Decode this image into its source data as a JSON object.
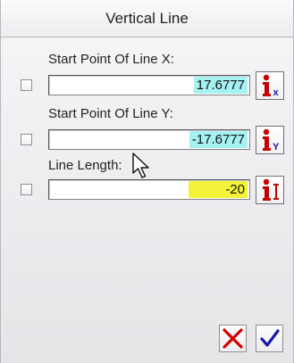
{
  "dialog": {
    "title": "Vertical Line"
  },
  "fields": [
    {
      "label": "Start Point Of Line X:",
      "value": "17.6777",
      "highlight": "#a6f2f3",
      "icon": "info-x-icon",
      "icon_sub": "x",
      "checked": false
    },
    {
      "label": "Start Point Of Line Y:",
      "value": "-17.6777",
      "highlight": "#a6f2f3",
      "icon": "info-y-icon",
      "icon_sub": "Y",
      "checked": false
    },
    {
      "label": "Line Length:",
      "value": "-20",
      "highlight": "#f3f33a",
      "icon": "length-icon",
      "icon_sub": "",
      "checked": false
    }
  ],
  "actions": {
    "cancel_icon": "red-x-icon",
    "ok_icon": "blue-check-icon"
  },
  "colors": {
    "icon_red": "#c40000",
    "icon_blue": "#1a1aa8"
  }
}
